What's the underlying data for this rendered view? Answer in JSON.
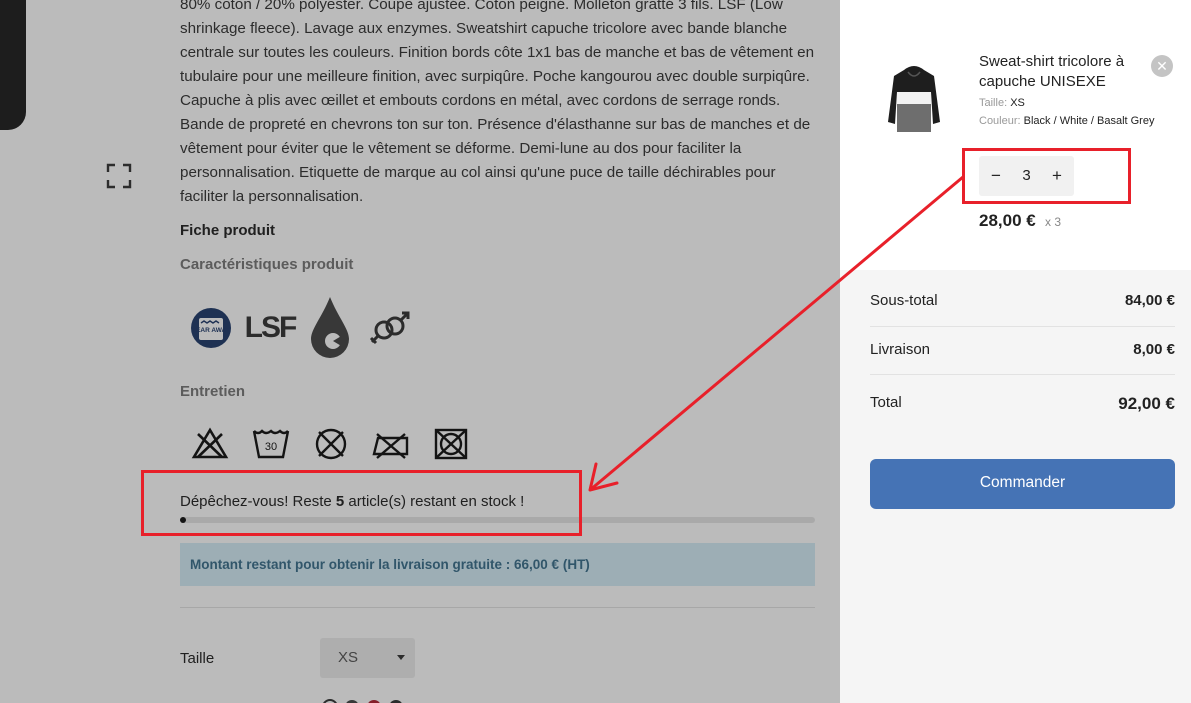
{
  "product": {
    "description": "80% coton / 20% polyester. Coupe ajustée. Coton peigné. Molleton gratté 3 fils. LSF (Low shrinkage fleece). Lavage aux enzymes. Sweatshirt capuche tricolore avec bande blanche centrale sur toutes les couleurs. Finition bords côte 1x1 bas de manche et bas de vêtement en tubulaire pour une meilleure finition, avec surpiqûre. Poche kangourou avec double surpiqûre. Capuche à plis avec œillet et embouts cordons en métal, avec cordons de serrage ronds. Bande de propreté en chevrons ton sur ton. Présence d'élasthanne sur bas de manches et de vêtement pour éviter que le vêtement se déforme. Demi-lune au dos pour faciliter la personnalisation. Etiquette de marque au col ainsi qu'une puce de taille déchirables pour faciliter la personnalisation.",
    "fiche_heading": "Fiche produit",
    "features_heading": "Caractéristiques produit",
    "features": [
      {
        "icon": "tear-away-label-icon",
        "text": "TEAR AWAY"
      },
      {
        "icon": "lsf-icon",
        "text": "LSF"
      },
      {
        "icon": "drop-icon"
      },
      {
        "icon": "unisex-icon"
      }
    ],
    "care_heading": "Entretien",
    "care_icons": [
      "no-bleach-icon",
      "wash-30-icon",
      "no-tumble-dry-icon",
      "no-iron-icon",
      "no-dry-clean-icon"
    ],
    "care_wash_temp": "30",
    "stock": {
      "prefix": "Dépêchez-vous! Reste ",
      "count": "5",
      "suffix": " article(s) restant en stock !",
      "level": 0.01
    },
    "free_shipping_text": "Montant restant pour obtenir la livraison gratuite : 66,00 € (HT)",
    "size_label": "Taille",
    "size_value": "XS"
  },
  "cart": {
    "item": {
      "title": "Sweat-shirt tricolore à capuche UNISEXE",
      "remove_icon": "close-icon",
      "size_key": "Taille:",
      "size_value": "XS",
      "color_key": "Couleur:",
      "color_value": "Black / White / Basalt Grey",
      "qty_minus": "−",
      "qty_value": "3",
      "qty_plus": "+",
      "price": "28,00 €",
      "times": "x 3"
    },
    "summary": {
      "subtotal_label": "Sous-total",
      "subtotal_value": "84,00 €",
      "shipping_label": "Livraison",
      "shipping_value": "8,00 €",
      "total_label": "Total",
      "total_value": "92,00 €"
    },
    "checkout_label": "Commander"
  },
  "colors": {
    "accent": "#4573b5",
    "annotation": "#e8202a",
    "shipping_box": "#d4ecf7",
    "overlay": "rgba(30,30,30,0.30)"
  }
}
